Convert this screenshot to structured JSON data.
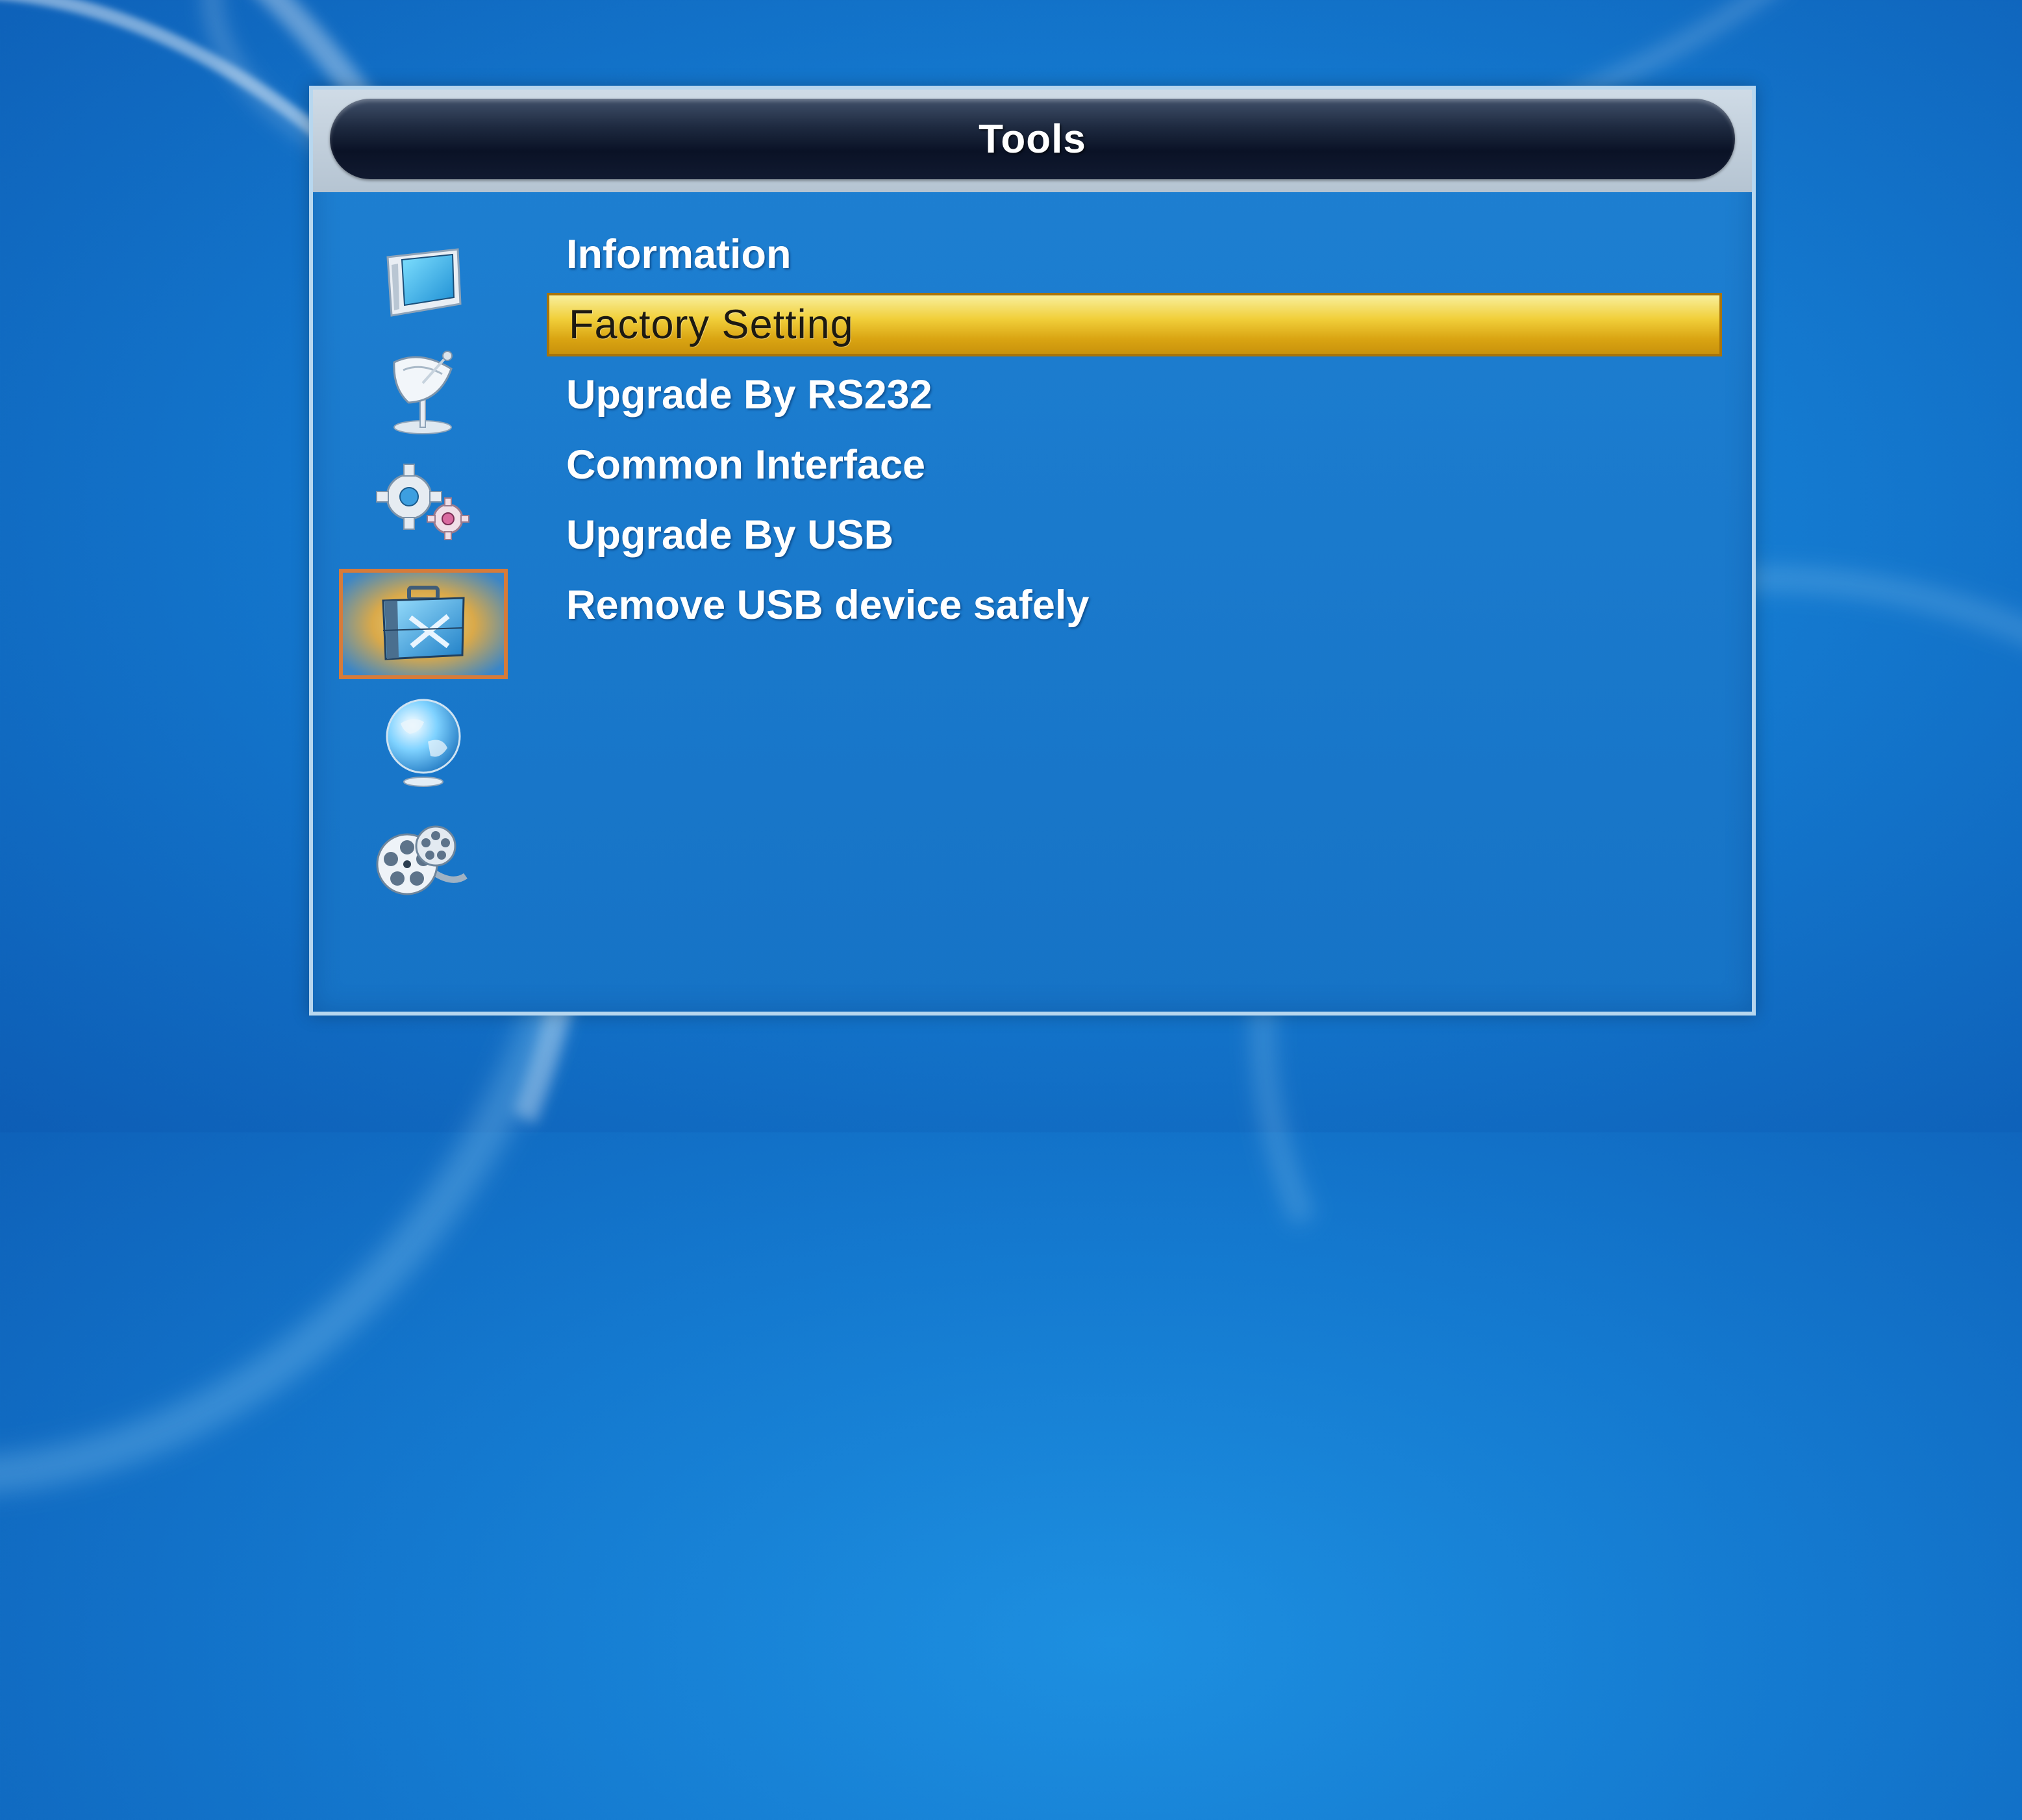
{
  "window": {
    "title": "Tools"
  },
  "sidebar": {
    "icons": [
      {
        "name": "tv-icon",
        "active": false
      },
      {
        "name": "satellite-dish-icon",
        "active": false
      },
      {
        "name": "gears-icon",
        "active": false
      },
      {
        "name": "toolbox-icon",
        "active": true
      },
      {
        "name": "globe-icon",
        "active": false
      },
      {
        "name": "film-reel-icon",
        "active": false
      }
    ]
  },
  "menu": {
    "selected_index": 1,
    "items": [
      {
        "label": "Information"
      },
      {
        "label": "Factory Setting"
      },
      {
        "label": "Upgrade By RS232"
      },
      {
        "label": "Common Interface"
      },
      {
        "label": "Upgrade By USB"
      },
      {
        "label": "Remove USB device safely"
      }
    ]
  },
  "colors": {
    "highlight": "#f1cf3a",
    "active_icon_border": "#d67b3a",
    "panel": "#1673c6"
  }
}
